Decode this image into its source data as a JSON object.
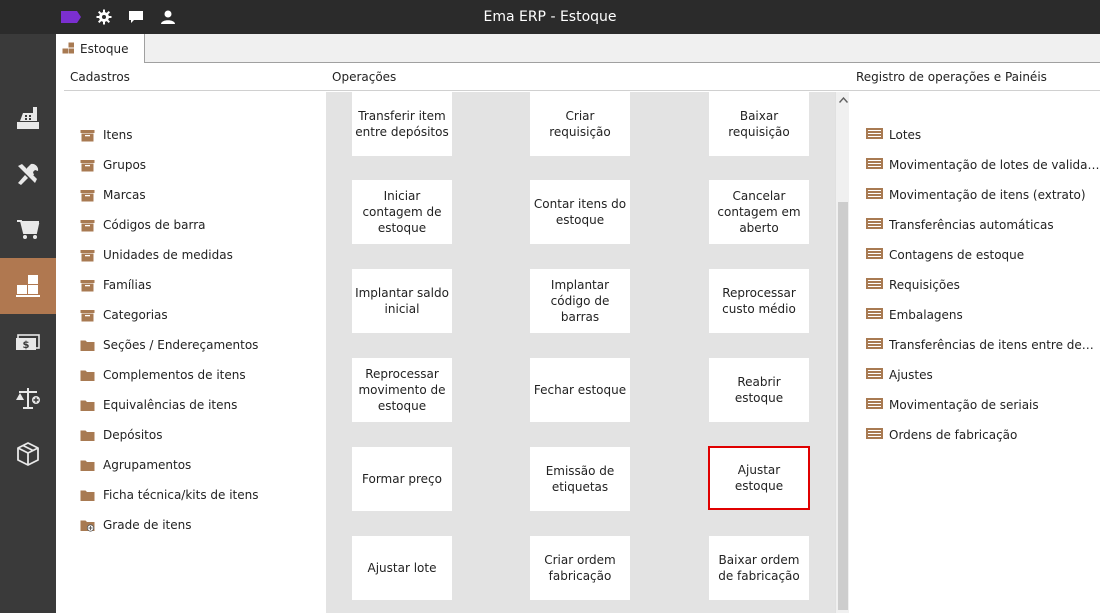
{
  "window": {
    "title": "Ema ERP - Estoque"
  },
  "toolbar_icons": [
    "brand-logo-icon",
    "gear-icon",
    "chat-icon",
    "user-icon"
  ],
  "rail": {
    "items": [
      {
        "icon": "cash-register-icon"
      },
      {
        "icon": "tools-icon"
      },
      {
        "icon": "cart-icon"
      },
      {
        "icon": "stock-boxes-icon",
        "active": true
      },
      {
        "icon": "money-icon"
      },
      {
        "icon": "balance-scale-icon"
      },
      {
        "icon": "package-icon"
      }
    ],
    "active_color": "#b07850"
  },
  "tab": {
    "label": "Estoque"
  },
  "sections": {
    "cadastros": "Cadastros",
    "operacoes": "Operações",
    "registro": "Registro de operações e Painéis"
  },
  "cadastros": [
    {
      "label": "Itens",
      "icon": "box-icon"
    },
    {
      "label": "Grupos",
      "icon": "box-icon"
    },
    {
      "label": "Marcas",
      "icon": "box-icon"
    },
    {
      "label": "Códigos de barra",
      "icon": "box-icon"
    },
    {
      "label": "Unidades de medidas",
      "icon": "box-icon"
    },
    {
      "label": "Famílias",
      "icon": "box-icon"
    },
    {
      "label": "Categorias",
      "icon": "box-icon"
    },
    {
      "label": "Seções / Endereçamentos",
      "icon": "folder-icon"
    },
    {
      "label": "Complementos de itens",
      "icon": "folder-icon"
    },
    {
      "label": "Equivalências de itens",
      "icon": "folder-icon"
    },
    {
      "label": "Depósitos",
      "icon": "folder-icon"
    },
    {
      "label": "Agrupamentos",
      "icon": "folder-icon"
    },
    {
      "label": "Ficha técnica/kits de itens",
      "icon": "folder-icon"
    },
    {
      "label": "Grade de itens",
      "icon": "folder-plus-icon"
    }
  ],
  "operacoes": [
    "Transferir item entre depósitos",
    "Criar requisição",
    "Baixar requisição",
    "Iniciar contagem de estoque",
    "Contar itens do estoque",
    "Cancelar contagem em aberto",
    "Implantar saldo inicial",
    "Implantar código de barras",
    "Reprocessar custo médio",
    "Reprocessar movimento de estoque",
    "Fechar estoque",
    "Reabrir estoque",
    "Formar preço",
    "Emissão de etiquetas",
    "Ajustar estoque",
    "Ajustar lote",
    "Criar ordem fabricação",
    "Baixar ordem de fabricação"
  ],
  "highlighted_operation": "Ajustar estoque",
  "highlight_color": "#e00000",
  "registro": [
    "Lotes",
    "Movimentação de lotes de validade",
    "Movimentação de itens (extrato)",
    "Transferências automáticas",
    "Contagens de estoque",
    "Requisições",
    "Embalagens",
    "Transferências de itens entre depósi...",
    "Ajustes",
    "Movimentação de seriais",
    "Ordens de fabricação"
  ],
  "accent_color": "#a87a52"
}
